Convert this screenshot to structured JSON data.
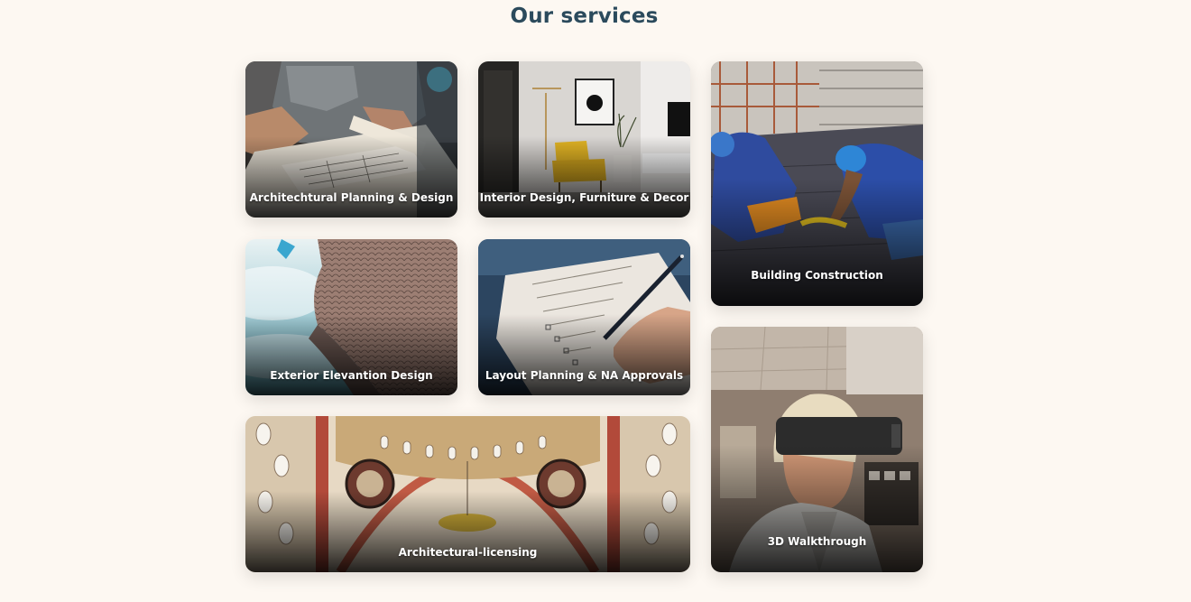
{
  "page": {
    "title": "Our services"
  },
  "services": [
    {
      "label": "Architechtural Planning & Design",
      "image": "architect-drawing-blueprints-photo"
    },
    {
      "label": "Interior Design, Furniture & Decor",
      "image": "yellow-armchair-interior-photo"
    },
    {
      "label": "Building Construction",
      "image": "construction-workers-hardhats-photo"
    },
    {
      "label": "Exterior Elevantion Design",
      "image": "facade-building-sky-photo"
    },
    {
      "label": "Layout Planning & NA Approvals",
      "image": "hand-writing-checklist-photo"
    },
    {
      "label": "Architectural-licensing",
      "image": "mosque-dome-ceiling-photo"
    },
    {
      "label": "3D Walkthrough",
      "image": "man-vr-headset-photo"
    }
  ],
  "colors": {
    "background": "#fdf8f2",
    "title": "#2b4a5c",
    "label": "#ffffff"
  }
}
